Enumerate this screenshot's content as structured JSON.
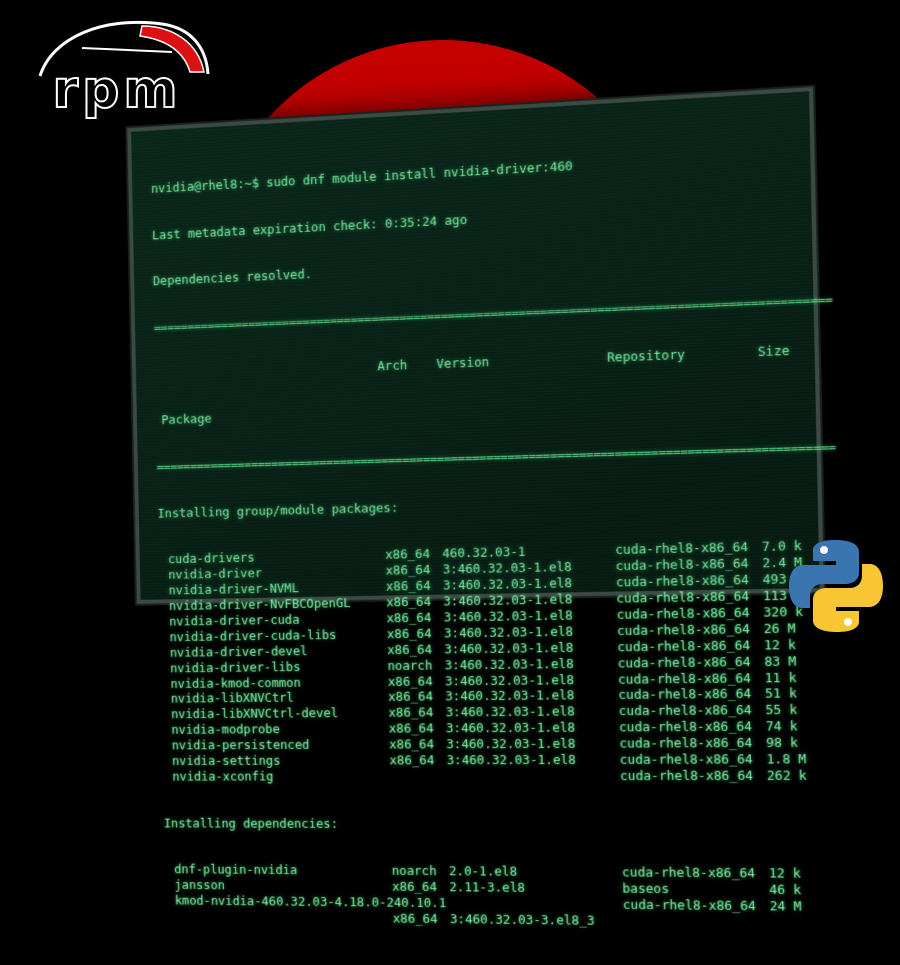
{
  "colors": {
    "background": "#000000",
    "orb_top": "#c40000",
    "orb_bottom": "#3fb816",
    "terminal_text": "#7df2a6",
    "terminal_bg": "#0b2619",
    "python_blue": "#3b75b0",
    "python_yellow": "#f7c632"
  },
  "logos": {
    "rpm_text": "rpm",
    "rpm_icon": "rpm-logo-icon",
    "python_icon": "python-logo-icon"
  },
  "terminal": {
    "prompt": "nvidia@rhel8:~$ sudo dnf module install nvidia-driver:460",
    "metadata": "Last metadata expiration check: 0:35:24 ago",
    "resolved": "Dependencies resolved.",
    "separator": "================================================================================================",
    "headers": {
      "package": "Package",
      "arch": "Arch",
      "version": "Version",
      "repository": "Repository",
      "size": "Size"
    },
    "section_group": "Installing group/module packages:",
    "group_packages": [
      {
        "name": "cuda-drivers",
        "arch": "x86_64",
        "version": "460.32.03-1",
        "repo": "cuda-rhel8-x86_64",
        "size": "7.0 k"
      },
      {
        "name": "nvidia-driver",
        "arch": "x86_64",
        "version": "3:460.32.03-1.el8",
        "repo": "cuda-rhel8-x86_64",
        "size": "2.4 M"
      },
      {
        "name": "nvidia-driver-NVML",
        "arch": "x86_64",
        "version": "3:460.32.03-1.el8",
        "repo": "cuda-rhel8-x86_64",
        "size": "493 k"
      },
      {
        "name": "nvidia-driver-NvFBCOpenGL",
        "arch": "x86_64",
        "version": "3:460.32.03-1.el8",
        "repo": "cuda-rhel8-x86_64",
        "size": "113 k"
      },
      {
        "name": "nvidia-driver-cuda",
        "arch": "x86_64",
        "version": "3:460.32.03-1.el8",
        "repo": "cuda-rhel8-x86_64",
        "size": "320 k"
      },
      {
        "name": "nvidia-driver-cuda-libs",
        "arch": "x86_64",
        "version": "3:460.32.03-1.el8",
        "repo": "cuda-rhel8-x86_64",
        "size": "26 M"
      },
      {
        "name": "nvidia-driver-devel",
        "arch": "x86_64",
        "version": "3:460.32.03-1.el8",
        "repo": "cuda-rhel8-x86_64",
        "size": "12 k"
      },
      {
        "name": "nvidia-driver-libs",
        "arch": "noarch",
        "version": "3:460.32.03-1.el8",
        "repo": "cuda-rhel8-x86_64",
        "size": "83 M"
      },
      {
        "name": "nvidia-kmod-common",
        "arch": "x86_64",
        "version": "3:460.32.03-1.el8",
        "repo": "cuda-rhel8-x86_64",
        "size": "11 k"
      },
      {
        "name": "nvidia-libXNVCtrl",
        "arch": "x86_64",
        "version": "3:460.32.03-1.el8",
        "repo": "cuda-rhel8-x86_64",
        "size": "51 k"
      },
      {
        "name": "nvidia-libXNVCtrl-devel",
        "arch": "x86_64",
        "version": "3:460.32.03-1.el8",
        "repo": "cuda-rhel8-x86_64",
        "size": "55 k"
      },
      {
        "name": "nvidia-modprobe",
        "arch": "x86_64",
        "version": "3:460.32.03-1.el8",
        "repo": "cuda-rhel8-x86_64",
        "size": "74 k"
      },
      {
        "name": "nvidia-persistenced",
        "arch": "x86_64",
        "version": "3:460.32.03-1.el8",
        "repo": "cuda-rhel8-x86_64",
        "size": "98 k"
      },
      {
        "name": "nvidia-settings",
        "arch": "x86_64",
        "version": "3:460.32.03-1.el8",
        "repo": "cuda-rhel8-x86_64",
        "size": "1.8 M"
      },
      {
        "name": "nvidia-xconfig",
        "arch": "",
        "version": "",
        "repo": "cuda-rhel8-x86_64",
        "size": "262 k"
      }
    ],
    "section_deps": "Installing dependencies:",
    "dep_packages": [
      {
        "name": "dnf-plugin-nvidia",
        "arch": "noarch",
        "version": "2.0-1.el8",
        "repo": "cuda-rhel8-x86_64",
        "size": "12 k"
      },
      {
        "name": "jansson",
        "arch": "x86_64",
        "version": "2.11-3.el8",
        "repo": "baseos",
        "size": "46 k"
      },
      {
        "name": "kmod-nvidia-460.32.03-4.18.0-240.10.1",
        "arch": "",
        "version": "",
        "repo": "cuda-rhel8-x86_64",
        "size": "24 M"
      },
      {
        "name": "",
        "arch": "x86_64",
        "version": "3:460.32.03-3.el8_3",
        "repo": "",
        "size": ""
      }
    ]
  }
}
